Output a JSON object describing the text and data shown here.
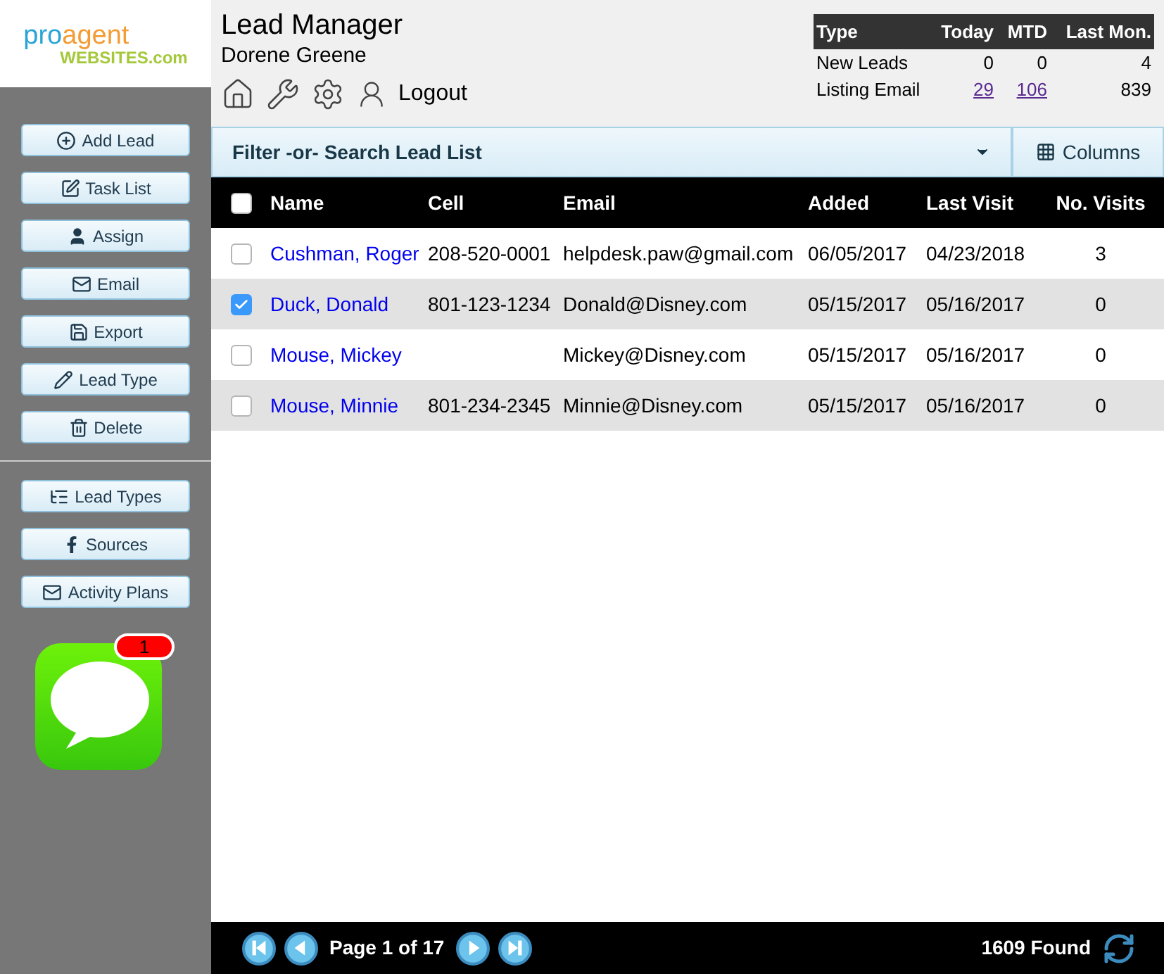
{
  "logo": {
    "part_1": "pro",
    "part_2": "agent",
    "part_3": "WEBSITES.com"
  },
  "sidebar": {
    "actions": [
      {
        "label": "Add Lead",
        "kind": "add"
      },
      {
        "label": "Task List",
        "kind": "tasks"
      },
      {
        "label": "Assign",
        "kind": "user"
      },
      {
        "label": "Email",
        "kind": "mail"
      },
      {
        "label": "Export",
        "kind": "save"
      },
      {
        "label": "Lead Type",
        "kind": "pencil"
      },
      {
        "label": "Delete",
        "kind": "trash"
      }
    ],
    "settings": [
      {
        "label": "Lead Types",
        "kind": "list"
      },
      {
        "label": "Sources",
        "kind": "facebook"
      },
      {
        "label": "Activity Plans",
        "kind": "plans"
      }
    ],
    "messages_badge": "1"
  },
  "header": {
    "title": "Lead Manager",
    "user": "Dorene Greene",
    "logout": "Logout"
  },
  "stats": {
    "columns": [
      "Type",
      "Today",
      "MTD",
      "Last Mon."
    ],
    "rows": [
      {
        "cells": [
          "New Leads",
          "0",
          "0",
          "4"
        ],
        "links": [
          false,
          false,
          false,
          false
        ]
      },
      {
        "cells": [
          "Listing Email",
          "29",
          "106",
          "839"
        ],
        "links": [
          false,
          true,
          true,
          false
        ]
      }
    ]
  },
  "filter": {
    "placeholder": "Filter -or- Search Lead List",
    "columns_button": "Columns"
  },
  "table": {
    "columns": [
      "Name",
      "Cell",
      "Email",
      "Added",
      "Last Visit",
      "No. Visits"
    ],
    "all_checked": false,
    "rows": [
      {
        "checked": false,
        "cells": [
          "Cushman, Roger",
          "208-520-0001",
          "helpdesk.paw@gmail.com",
          "06/05/2017",
          "04/23/2018",
          "3"
        ]
      },
      {
        "checked": true,
        "cells": [
          "Duck, Donald",
          "801-123-1234",
          "Donald@Disney.com",
          "05/15/2017",
          "05/16/2017",
          "0"
        ]
      },
      {
        "checked": false,
        "cells": [
          "Mouse, Mickey",
          "",
          "Mickey@Disney.com",
          "05/15/2017",
          "05/16/2017",
          "0"
        ]
      },
      {
        "checked": false,
        "cells": [
          "Mouse, Minnie",
          "801-234-2345",
          "Minnie@Disney.com",
          "05/15/2017",
          "05/16/2017",
          "0"
        ]
      }
    ]
  },
  "pager": {
    "page": "Page 1 of 17",
    "found": "1609 Found"
  }
}
